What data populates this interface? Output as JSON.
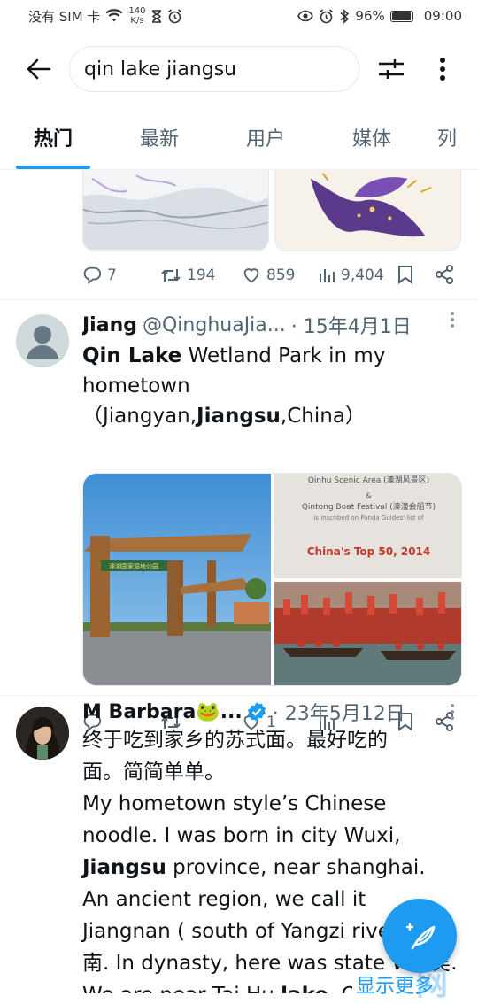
{
  "status": {
    "carrier": "没有 SIM 卡",
    "speed_value": "140",
    "speed_unit": "K/s",
    "battery": "96%",
    "time": "09:00"
  },
  "search": {
    "query": "qin lake jiangsu"
  },
  "tabs": [
    {
      "label": "热门"
    },
    {
      "label": "最新"
    },
    {
      "label": "用户"
    },
    {
      "label": "媒体"
    },
    {
      "label": "列"
    }
  ],
  "prev_tweet": {
    "replies": "7",
    "retweets": "194",
    "likes": "859",
    "views": "9,404"
  },
  "tweet1": {
    "name": "Jiang",
    "handle": "@QinghuaJia...",
    "date": "· 15年4月1日",
    "text_parts": [
      "Qin Lake",
      " Wetland Park in my hometown（Jiangyan,",
      "Jiangsu",
      ",China）"
    ],
    "photo2_lines": [
      "Qinhu Scenic Area (溱湖风景区)",
      "&",
      "Qintong Boat Festival (溱潼会船节)",
      "is inscribed on Panda Guides' list of",
      "China's Top 50, 2014"
    ],
    "gate_sign": "溱湖国家湿地公园",
    "likes": "1"
  },
  "tweet2": {
    "name": "M Barbara🐸...",
    "date": "· 23年5月12日",
    "line1": "终于吃到家乡的苏式面。最好吃的面。简简单单。",
    "line2a": "My hometown style’s Chinese noodle. I was born in city Wuxi, ",
    "line2b": "Jiangsu",
    "line2c": " province, near shanghai. An ancient region, we call it Jiangnan ( south of Yangzi river ) 江南. In ",
    "line2d": "dynasty, here was state Wu 吴. We are near Tai Hu ",
    "line2e": "lake",
    "line2f": ". Our...",
    "show_more": "显示更多"
  },
  "watermark": "水网",
  "colors": {
    "accent": "#1d9bf0",
    "text": "#0f1419",
    "muted": "#536471"
  }
}
